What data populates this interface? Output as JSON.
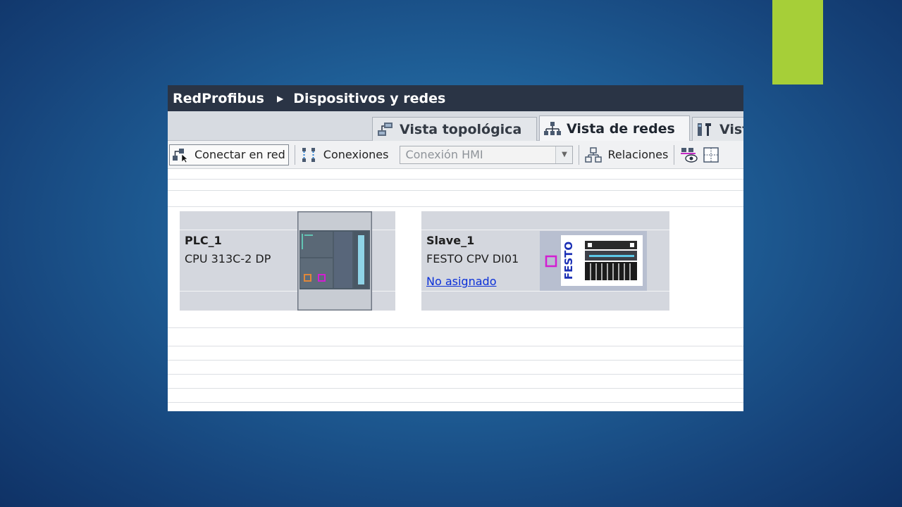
{
  "breadcrumb": {
    "project": "RedProfibus",
    "page": "Dispositivos y redes"
  },
  "tabs": [
    {
      "label": "Vista topológica",
      "icon": "topology-icon"
    },
    {
      "label": "Vista de redes",
      "icon": "network-icon",
      "active": true
    },
    {
      "label": "Vista",
      "icon": "device-view-icon"
    }
  ],
  "toolbar": {
    "connect_label": "Conectar en red",
    "connections_label": "Conexiones",
    "connection_type": "Conexión HMI",
    "relations_label": "Relaciones"
  },
  "devices": [
    {
      "name": "PLC_1",
      "model": "CPU 313C-2 DP"
    },
    {
      "name": "Slave_1",
      "model": "FESTO CPV DI01",
      "status": "No asignado",
      "logo_text": "FESTO"
    }
  ],
  "colors": {
    "accent": "#a6cf38",
    "titlebar": "#2a3445",
    "link": "#0a2fd8",
    "port_magenta": "#d21ed2",
    "port_orange": "#e0873a"
  }
}
